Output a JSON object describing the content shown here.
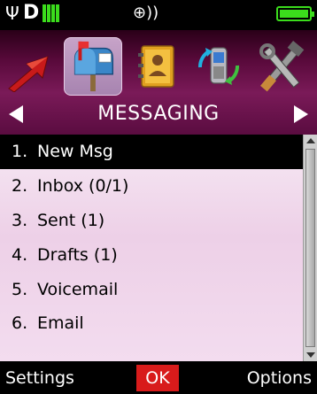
{
  "status_bar": {
    "antenna_glyph": "Ψ",
    "network_letter": "D",
    "signal_bars": 4,
    "alert_mode_glyph": "⊕))",
    "battery_level": 1.0,
    "accent_color": "#3bdc1c"
  },
  "header": {
    "icons": [
      {
        "name": "send-arrow-icon",
        "selected": false
      },
      {
        "name": "mailbox-icon",
        "selected": true
      },
      {
        "name": "contacts-book-icon",
        "selected": false
      },
      {
        "name": "phone-sync-icon",
        "selected": false
      },
      {
        "name": "tools-icon",
        "selected": false
      }
    ],
    "title": "MESSAGING"
  },
  "menu": {
    "items": [
      {
        "number": "1.",
        "label": "New Msg",
        "selected": true
      },
      {
        "number": "2.",
        "label": "Inbox (0/1)",
        "selected": false
      },
      {
        "number": "3.",
        "label": "Sent (1)",
        "selected": false
      },
      {
        "number": "4.",
        "label": "Drafts (1)",
        "selected": false
      },
      {
        "number": "5.",
        "label": "Voicemail",
        "selected": false
      },
      {
        "number": "6.",
        "label": "Email",
        "selected": false
      }
    ]
  },
  "softkeys": {
    "left": "Settings",
    "center": "OK",
    "right": "Options"
  }
}
